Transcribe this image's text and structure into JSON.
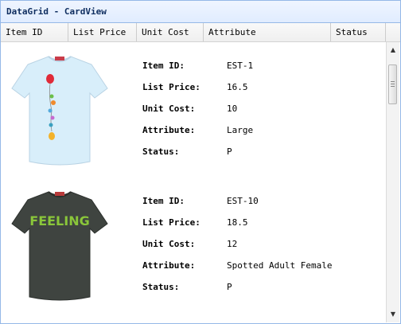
{
  "panel": {
    "title": "DataGrid - CardView"
  },
  "columns": [
    "Item ID",
    "List Price",
    "Unit Cost",
    "Attribute",
    "Status"
  ],
  "labels": {
    "item_id": "Item ID:",
    "list_price": "List Price:",
    "unit_cost": "Unit Cost:",
    "attribute": "Attribute:",
    "status": "Status:"
  },
  "rows": [
    {
      "item_id": "EST-1",
      "list_price": "16.5",
      "unit_cost": "10",
      "attribute": "Large",
      "status": "P",
      "shirt_color": "#d8eefa",
      "image_text": ""
    },
    {
      "item_id": "EST-10",
      "list_price": "18.5",
      "unit_cost": "12",
      "attribute": "Spotted Adult Female",
      "status": "P",
      "shirt_color": "#3f4440",
      "image_text": "FEELING"
    }
  ],
  "scrollbar": {
    "up_icon": "scroll-up-arrow-icon",
    "down_icon": "scroll-down-arrow-icon"
  },
  "colors": {
    "title_text": "#0e2d5f",
    "panel_border": "#95b8e7",
    "header_bg": "#efefef"
  }
}
